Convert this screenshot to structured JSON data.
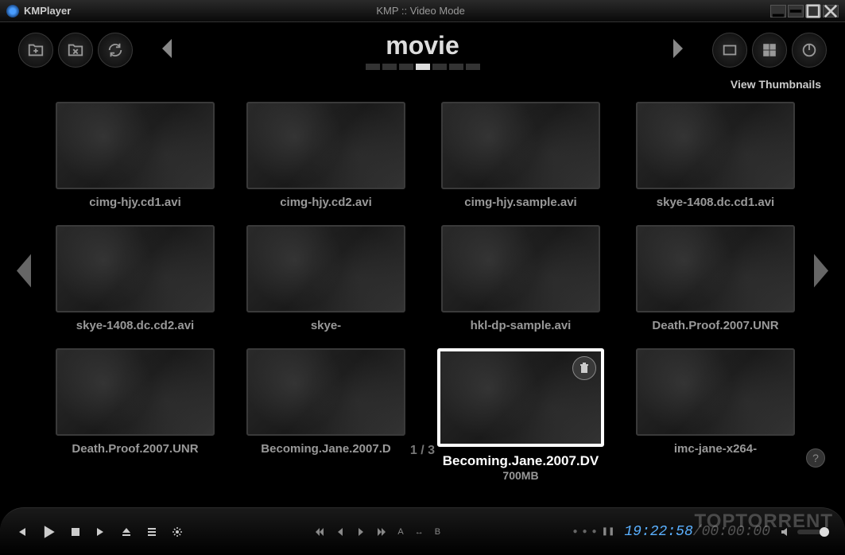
{
  "app": {
    "name": "KMPlayer",
    "window_title": "KMP :: Video Mode"
  },
  "nav": {
    "category_title": "movie",
    "view_mode_label": "View Thumbnails",
    "page_indicator": "1 / 3"
  },
  "thumbnails": [
    {
      "label": "cimg-hjy.cd1.avi"
    },
    {
      "label": "cimg-hjy.cd2.avi"
    },
    {
      "label": "cimg-hjy.sample.avi"
    },
    {
      "label": "skye-1408.dc.cd1.avi"
    },
    {
      "label": "skye-1408.dc.cd2.avi"
    },
    {
      "label": "skye-"
    },
    {
      "label": "hkl-dp-sample.avi"
    },
    {
      "label": "Death.Proof.2007.UNR"
    },
    {
      "label": "Death.Proof.2007.UNR"
    },
    {
      "label": "Becoming.Jane.2007.D"
    },
    {
      "label": "Becoming.Jane.2007.DV",
      "size": "700MB",
      "selected": true
    },
    {
      "label": "imc-jane-x264-"
    }
  ],
  "playback": {
    "current_time": "19:22:58",
    "total_time": "00:00:00",
    "ab_label_a": "A",
    "ab_label_b": "B",
    "ab_arrow": "↔"
  },
  "help_label": "?",
  "watermark": "TOPTORRENT"
}
